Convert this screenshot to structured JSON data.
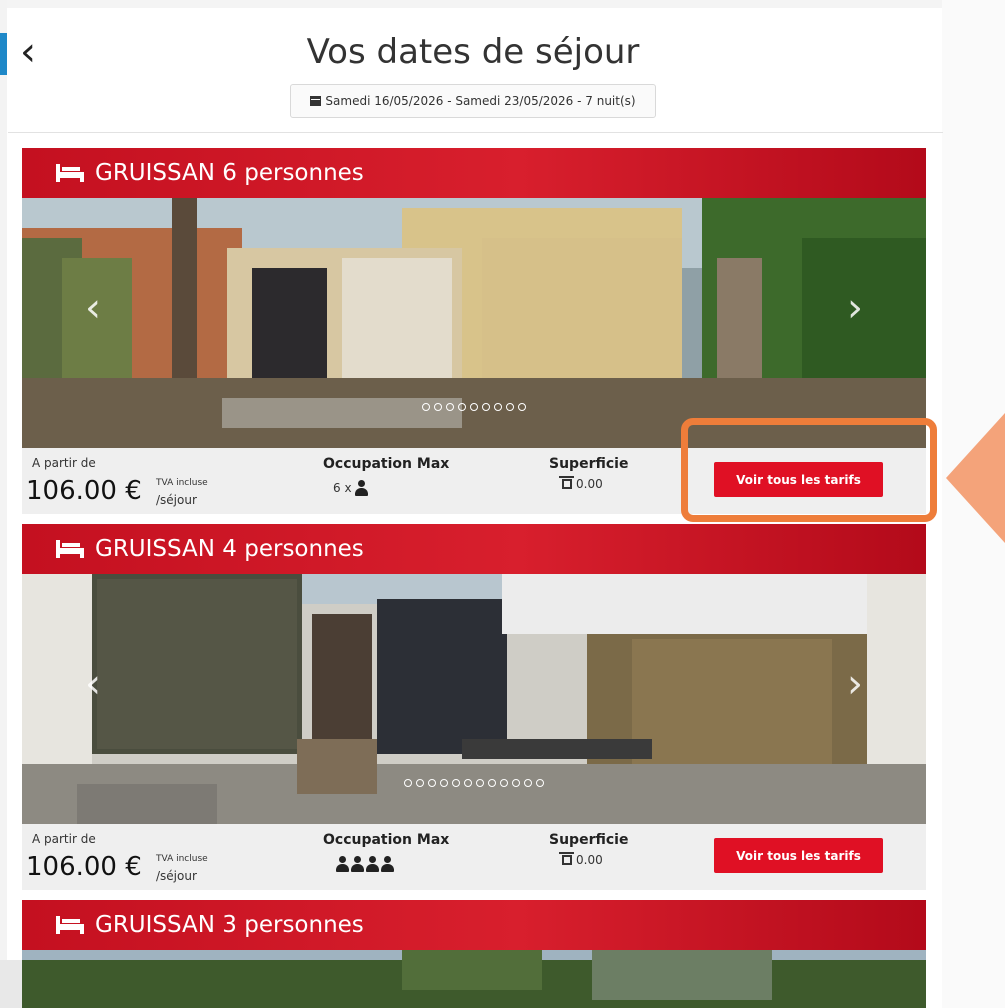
{
  "header": {
    "back_icon": "chevron-left",
    "title": "Vos dates de séjour",
    "dates": "Samedi 16/05/2026 - Samedi 23/05/2026 - 7 nuit(s)"
  },
  "labels": {
    "from": "A partir de",
    "tva": "TVA incluse",
    "per_stay": "/séjour",
    "occupation": "Occupation Max",
    "area": "Superficie",
    "button": "Voir tous les tarifs"
  },
  "cards": [
    {
      "title": "GRUISSAN 6 personnes",
      "price": "106.00 €",
      "occupancy_text": "6 x",
      "occupancy_icons": 1,
      "area": "0.00",
      "slide_count": 9
    },
    {
      "title": "GRUISSAN 4 personnes",
      "price": "106.00 €",
      "occupancy_text": "",
      "occupancy_icons": 4,
      "area": "0.00",
      "slide_count": 12
    },
    {
      "title": "GRUISSAN 3 personnes"
    }
  ],
  "colors": {
    "brand_red": "#e01024",
    "banner_red": "#d81f2d",
    "highlight_orange": "#ee7d3a",
    "accent_blue": "#1e88c8"
  }
}
